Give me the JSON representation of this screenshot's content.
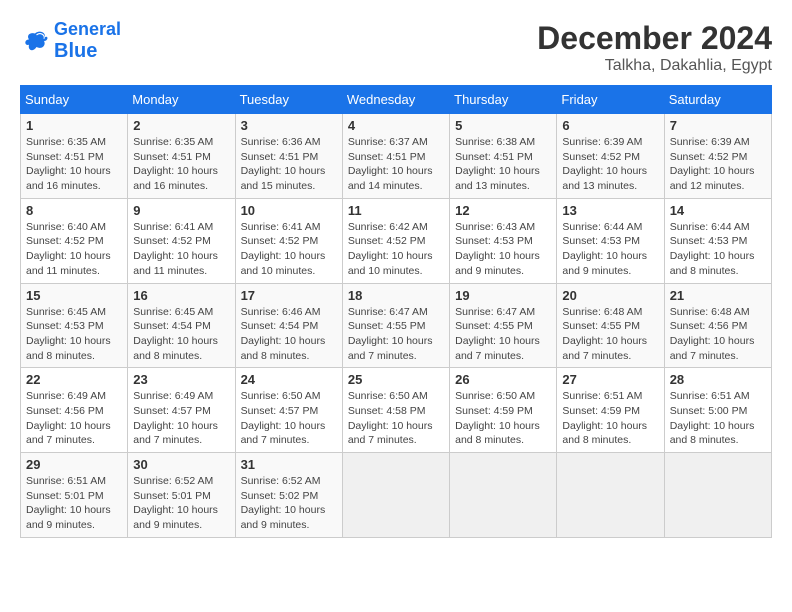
{
  "logo": {
    "text1": "General",
    "text2": "Blue"
  },
  "header": {
    "month": "December 2024",
    "location": "Talkha, Dakahlia, Egypt"
  },
  "weekdays": [
    "Sunday",
    "Monday",
    "Tuesday",
    "Wednesday",
    "Thursday",
    "Friday",
    "Saturday"
  ],
  "weeks": [
    [
      {
        "day": "1",
        "sunrise": "6:35 AM",
        "sunset": "4:51 PM",
        "daylight": "10 hours and 16 minutes."
      },
      {
        "day": "2",
        "sunrise": "6:35 AM",
        "sunset": "4:51 PM",
        "daylight": "10 hours and 16 minutes."
      },
      {
        "day": "3",
        "sunrise": "6:36 AM",
        "sunset": "4:51 PM",
        "daylight": "10 hours and 15 minutes."
      },
      {
        "day": "4",
        "sunrise": "6:37 AM",
        "sunset": "4:51 PM",
        "daylight": "10 hours and 14 minutes."
      },
      {
        "day": "5",
        "sunrise": "6:38 AM",
        "sunset": "4:51 PM",
        "daylight": "10 hours and 13 minutes."
      },
      {
        "day": "6",
        "sunrise": "6:39 AM",
        "sunset": "4:52 PM",
        "daylight": "10 hours and 13 minutes."
      },
      {
        "day": "7",
        "sunrise": "6:39 AM",
        "sunset": "4:52 PM",
        "daylight": "10 hours and 12 minutes."
      }
    ],
    [
      {
        "day": "8",
        "sunrise": "6:40 AM",
        "sunset": "4:52 PM",
        "daylight": "10 hours and 11 minutes."
      },
      {
        "day": "9",
        "sunrise": "6:41 AM",
        "sunset": "4:52 PM",
        "daylight": "10 hours and 11 minutes."
      },
      {
        "day": "10",
        "sunrise": "6:41 AM",
        "sunset": "4:52 PM",
        "daylight": "10 hours and 10 minutes."
      },
      {
        "day": "11",
        "sunrise": "6:42 AM",
        "sunset": "4:52 PM",
        "daylight": "10 hours and 10 minutes."
      },
      {
        "day": "12",
        "sunrise": "6:43 AM",
        "sunset": "4:53 PM",
        "daylight": "10 hours and 9 minutes."
      },
      {
        "day": "13",
        "sunrise": "6:44 AM",
        "sunset": "4:53 PM",
        "daylight": "10 hours and 9 minutes."
      },
      {
        "day": "14",
        "sunrise": "6:44 AM",
        "sunset": "4:53 PM",
        "daylight": "10 hours and 8 minutes."
      }
    ],
    [
      {
        "day": "15",
        "sunrise": "6:45 AM",
        "sunset": "4:53 PM",
        "daylight": "10 hours and 8 minutes."
      },
      {
        "day": "16",
        "sunrise": "6:45 AM",
        "sunset": "4:54 PM",
        "daylight": "10 hours and 8 minutes."
      },
      {
        "day": "17",
        "sunrise": "6:46 AM",
        "sunset": "4:54 PM",
        "daylight": "10 hours and 8 minutes."
      },
      {
        "day": "18",
        "sunrise": "6:47 AM",
        "sunset": "4:55 PM",
        "daylight": "10 hours and 7 minutes."
      },
      {
        "day": "19",
        "sunrise": "6:47 AM",
        "sunset": "4:55 PM",
        "daylight": "10 hours and 7 minutes."
      },
      {
        "day": "20",
        "sunrise": "6:48 AM",
        "sunset": "4:55 PM",
        "daylight": "10 hours and 7 minutes."
      },
      {
        "day": "21",
        "sunrise": "6:48 AM",
        "sunset": "4:56 PM",
        "daylight": "10 hours and 7 minutes."
      }
    ],
    [
      {
        "day": "22",
        "sunrise": "6:49 AM",
        "sunset": "4:56 PM",
        "daylight": "10 hours and 7 minutes."
      },
      {
        "day": "23",
        "sunrise": "6:49 AM",
        "sunset": "4:57 PM",
        "daylight": "10 hours and 7 minutes."
      },
      {
        "day": "24",
        "sunrise": "6:50 AM",
        "sunset": "4:57 PM",
        "daylight": "10 hours and 7 minutes."
      },
      {
        "day": "25",
        "sunrise": "6:50 AM",
        "sunset": "4:58 PM",
        "daylight": "10 hours and 7 minutes."
      },
      {
        "day": "26",
        "sunrise": "6:50 AM",
        "sunset": "4:59 PM",
        "daylight": "10 hours and 8 minutes."
      },
      {
        "day": "27",
        "sunrise": "6:51 AM",
        "sunset": "4:59 PM",
        "daylight": "10 hours and 8 minutes."
      },
      {
        "day": "28",
        "sunrise": "6:51 AM",
        "sunset": "5:00 PM",
        "daylight": "10 hours and 8 minutes."
      }
    ],
    [
      {
        "day": "29",
        "sunrise": "6:51 AM",
        "sunset": "5:01 PM",
        "daylight": "10 hours and 9 minutes."
      },
      {
        "day": "30",
        "sunrise": "6:52 AM",
        "sunset": "5:01 PM",
        "daylight": "10 hours and 9 minutes."
      },
      {
        "day": "31",
        "sunrise": "6:52 AM",
        "sunset": "5:02 PM",
        "daylight": "10 hours and 9 minutes."
      },
      null,
      null,
      null,
      null
    ]
  ]
}
